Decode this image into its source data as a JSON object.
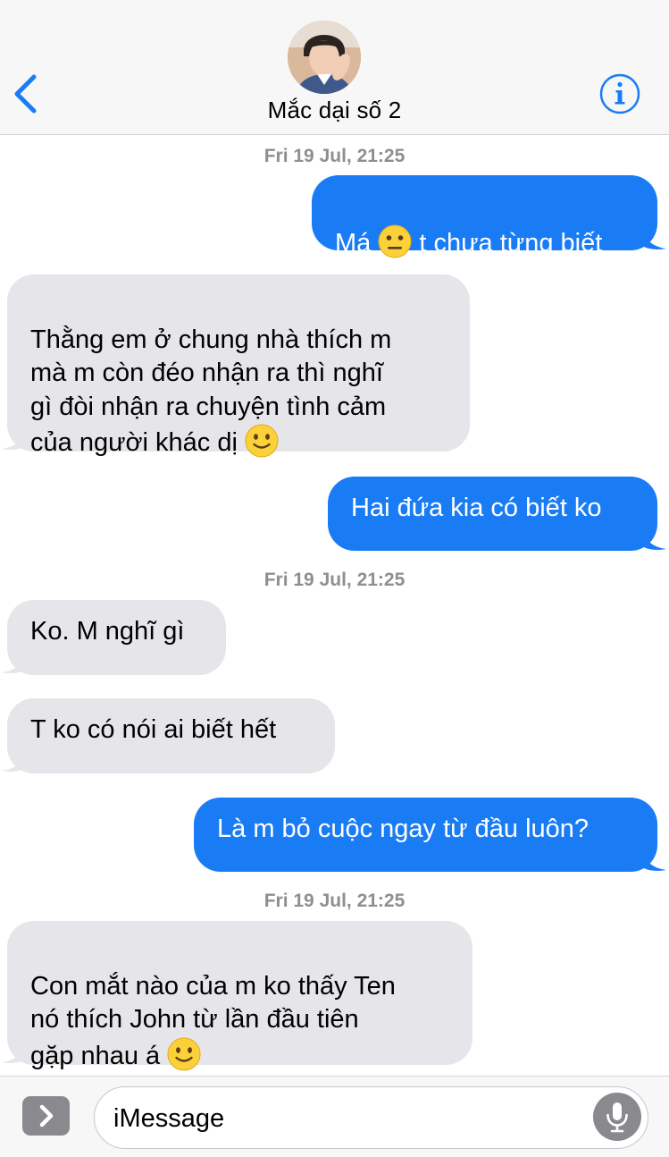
{
  "header": {
    "contact_name": "Mắc dại số 2",
    "back_icon": "chevron-left-icon",
    "info_icon": "info-icon",
    "accent_color": "#1a7cf5"
  },
  "timestamps": [
    "Fri 19 Jul, 21:25",
    "Fri 19 Jul, 21:25",
    "Fri 19 Jul, 21:25"
  ],
  "messages": [
    {
      "sender": "me",
      "before_emoji": "Má ",
      "emoji": "neutral-face",
      "after_emoji": " t chưa từng biết"
    },
    {
      "sender": "contact",
      "before_emoji": "Thằng em ở chung nhà thích m\nmà m còn đéo nhận ra thì nghĩ\ngì đòi nhận ra chuyện tình cảm\ncủa người khác dị ",
      "emoji": "slightly-smiling-face",
      "after_emoji": ""
    },
    {
      "sender": "me",
      "text": "Hai đứa kia có biết ko"
    },
    {
      "sender": "contact",
      "text": "Ko. M nghĩ gì"
    },
    {
      "sender": "contact",
      "text": "T ko có nói ai biết hết"
    },
    {
      "sender": "me",
      "text": "Là m bỏ cuộc ngay từ đầu luôn?"
    },
    {
      "sender": "contact",
      "before_emoji": "Con mắt nào của m ko thấy Ten\nnó thích John từ lần đầu tiên\ngặp nhau á ",
      "emoji": "slightly-smiling-face",
      "after_emoji": ""
    }
  ],
  "composer": {
    "placeholder": "iMessage",
    "expand_icon": "chevron-right-icon",
    "mic_icon": "microphone-icon"
  },
  "colors": {
    "sent_bubble": "#1a7cf5",
    "received_bubble": "#e6e5ea",
    "timestamp": "#8e8e93"
  }
}
